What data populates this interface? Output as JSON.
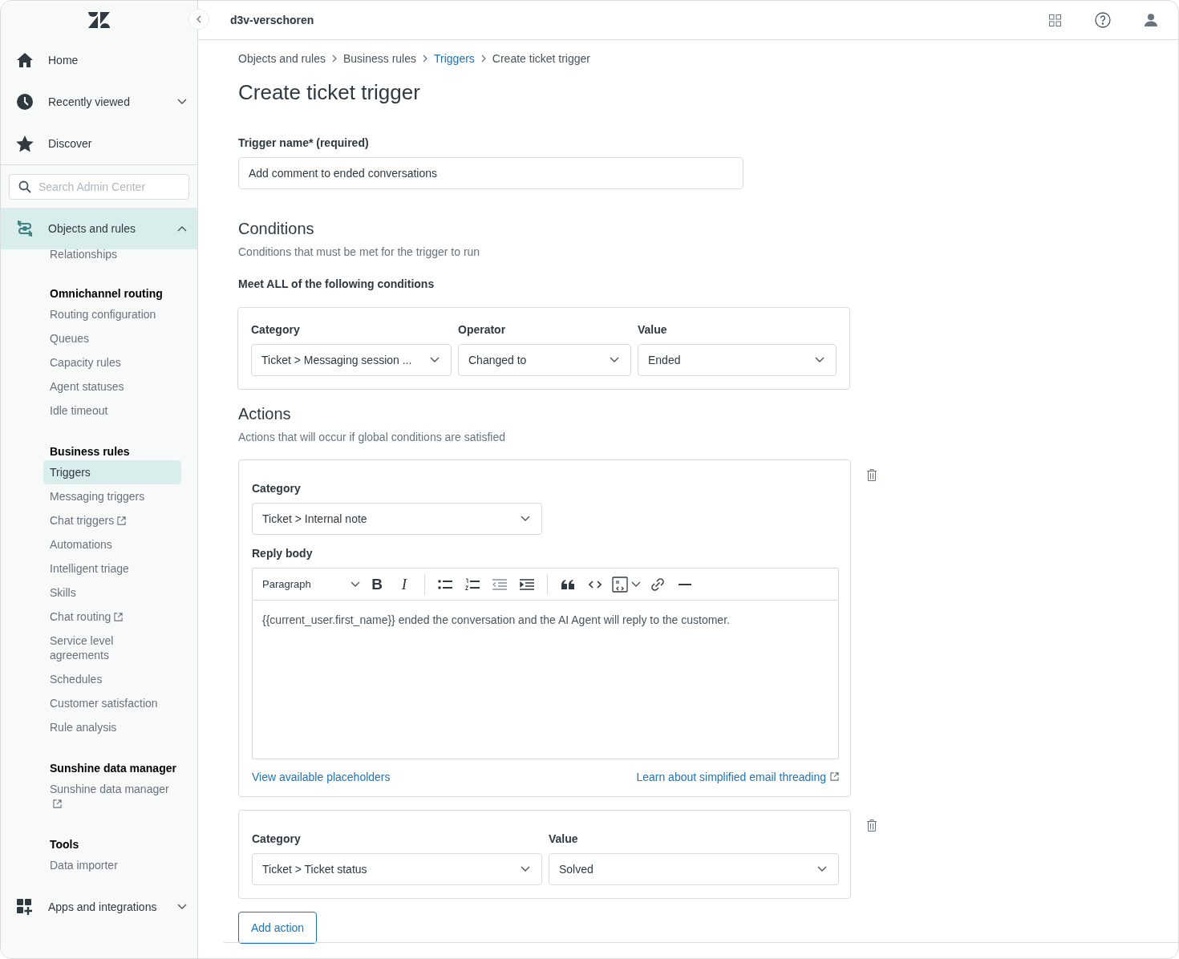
{
  "topbar": {
    "account": "d3v-verschoren"
  },
  "sidebar": {
    "top_items": [
      {
        "label": "Home",
        "kind": "link"
      },
      {
        "label": "Recently viewed",
        "kind": "expandable",
        "expanded": false
      },
      {
        "label": "Discover",
        "kind": "link"
      }
    ],
    "search": {
      "placeholder": "Search Admin Center"
    },
    "section": {
      "label": "Objects and rules",
      "expanded": true,
      "selected": true,
      "cut_item": "Relationships",
      "groups": [
        {
          "title": "Omnichannel routing",
          "items": [
            {
              "label": "Routing configuration",
              "selected": false,
              "external": false
            },
            {
              "label": "Queues",
              "selected": false,
              "external": false
            },
            {
              "label": "Capacity rules",
              "selected": false,
              "external": false
            },
            {
              "label": "Agent statuses",
              "selected": false,
              "external": false
            },
            {
              "label": "Idle timeout",
              "selected": false,
              "external": false
            }
          ]
        },
        {
          "title": "Business rules",
          "items": [
            {
              "label": "Triggers",
              "selected": true,
              "external": false
            },
            {
              "label": "Messaging triggers",
              "selected": false,
              "external": false
            },
            {
              "label": "Chat triggers",
              "selected": false,
              "external": true
            },
            {
              "label": "Automations",
              "selected": false,
              "external": false
            },
            {
              "label": "Intelligent triage",
              "selected": false,
              "external": false
            },
            {
              "label": "Skills",
              "selected": false,
              "external": false
            },
            {
              "label": "Chat routing",
              "selected": false,
              "external": true
            },
            {
              "label": "Service level agreements",
              "selected": false,
              "external": false
            },
            {
              "label": "Schedules",
              "selected": false,
              "external": false
            },
            {
              "label": "Customer satisfaction",
              "selected": false,
              "external": false
            },
            {
              "label": "Rule analysis",
              "selected": false,
              "external": false
            }
          ]
        },
        {
          "title": "Sunshine data manager",
          "items": [
            {
              "label": "Sunshine data manager",
              "selected": false,
              "external": true
            }
          ]
        },
        {
          "title": "Tools",
          "items": [
            {
              "label": "Data importer",
              "selected": false,
              "external": false
            }
          ]
        }
      ]
    },
    "bottom_items": [
      {
        "label": "Apps and integrations",
        "kind": "expandable",
        "expanded": false
      }
    ]
  },
  "breadcrumb": [
    {
      "label": "Objects and rules",
      "link": false
    },
    {
      "label": "Business rules",
      "link": false
    },
    {
      "label": "Triggers",
      "link": true
    },
    {
      "label": "Create ticket trigger",
      "link": false
    }
  ],
  "title": "Create ticket trigger",
  "trigger_name": {
    "label": "Trigger name* (required)",
    "value": "Add comment to ended conversations"
  },
  "conditions": {
    "heading": "Conditions",
    "description": "Conditions that must be met for the trigger to run",
    "match_label": "Meet ALL of the following conditions",
    "rows": [
      {
        "fields": [
          {
            "label": "Category",
            "value": "Ticket > Messaging session ..."
          },
          {
            "label": "Operator",
            "value": "Changed to"
          },
          {
            "label": "Value",
            "value": "Ended"
          }
        ]
      }
    ]
  },
  "actions": {
    "heading": "Actions",
    "description": "Actions that will occur if global conditions are satisfied",
    "items": [
      {
        "kind": "note",
        "fields": [
          {
            "label": "Category",
            "value": "Ticket > Internal note"
          }
        ],
        "body_label": "Reply body",
        "toolbar": {
          "format": "Paragraph",
          "bold": "B",
          "italic": "I"
        },
        "body": "{{current_user.first_name}} ended the conversation and the AI Agent will reply to the customer.",
        "link_left": "View available placeholders",
        "link_right": "Learn about simplified email threading"
      },
      {
        "kind": "field",
        "fields": [
          {
            "label": "Category",
            "value": "Ticket > Ticket status"
          },
          {
            "label": "Value",
            "value": "Solved"
          }
        ]
      }
    ],
    "add_button": "Add action"
  }
}
